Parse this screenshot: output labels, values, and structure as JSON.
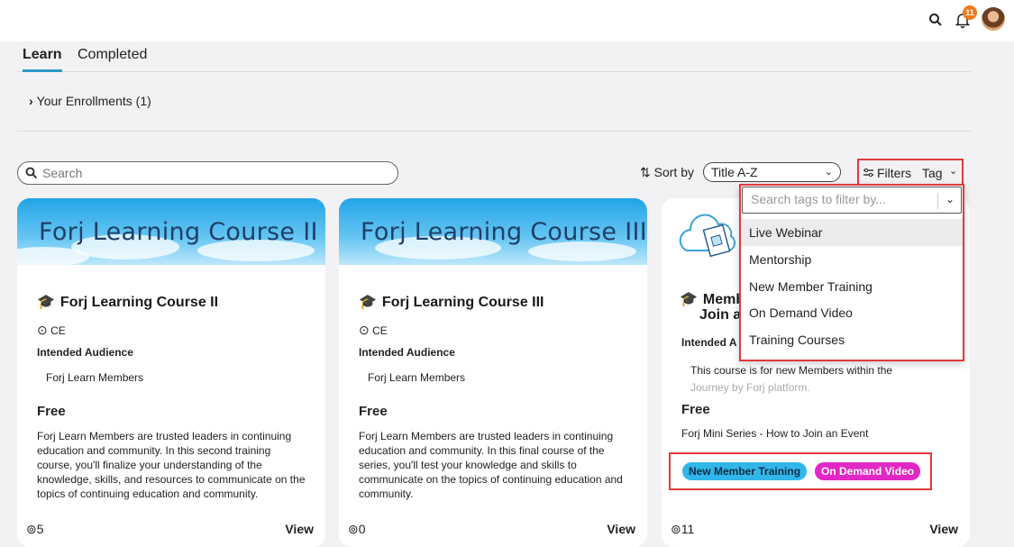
{
  "header": {
    "notification_count": "11",
    "icons": [
      "search-icon",
      "bell-icon",
      "avatar"
    ]
  },
  "tabs": [
    {
      "label": "Learn",
      "active": true
    },
    {
      "label": "Completed",
      "active": false
    }
  ],
  "enrollments": {
    "label": "Your Enrollments (1)"
  },
  "search": {
    "placeholder": "Search"
  },
  "sort": {
    "label": "Sort by",
    "value": "Title A-Z"
  },
  "filters": {
    "label": "Filters",
    "tag_label": "Tag"
  },
  "tag_dropdown": {
    "placeholder": "Search tags to filter by...",
    "options": [
      "Live Webinar",
      "Mentorship",
      "New Member Training",
      "On Demand Video",
      "Training Courses"
    ]
  },
  "cards": [
    {
      "banner": "Forj Learning Course II",
      "title": "Forj Learning Course II",
      "credit": "CE",
      "audience_heading": "Intended Audience",
      "audience": "Forj Learn Members",
      "price": "Free",
      "description": "Forj Learn Members are trusted leaders in continuing education and community. In this second training course, you'll finalize your understanding of the knowledge, skills, and resources to communicate on the topics of continuing education and community.",
      "count": "5",
      "view": "View"
    },
    {
      "banner": "Forj Learning Course III",
      "title": "Forj Learning Course III",
      "credit": "CE",
      "audience_heading": "Intended Audience",
      "audience": "Forj Learn Members",
      "price": "Free",
      "description": "Forj Learn Members are trusted leaders in continuing education and community. In this final course of the series, you'll test your knowledge and skills to communicate on the topics of continuing education and community.",
      "count": "0",
      "view": "View"
    },
    {
      "title_line1": "Memb",
      "title_line2": "Join a",
      "audience_heading": "Intended A",
      "audience_line1": "This course is for new Members within the",
      "audience_line2": "Journey by Forj platform.",
      "price": "Free",
      "series": "Forj Mini Series - How to Join an Event",
      "tags": [
        "New Member Training",
        "On Demand Video"
      ],
      "count": "11",
      "view": "View"
    }
  ],
  "colors": {
    "accent": "#2a9bc7",
    "highlight_box": "#e03a3a",
    "tag_blue": "#31b6ea",
    "tag_magenta": "#e327c6",
    "badge": "#f07a1a"
  }
}
